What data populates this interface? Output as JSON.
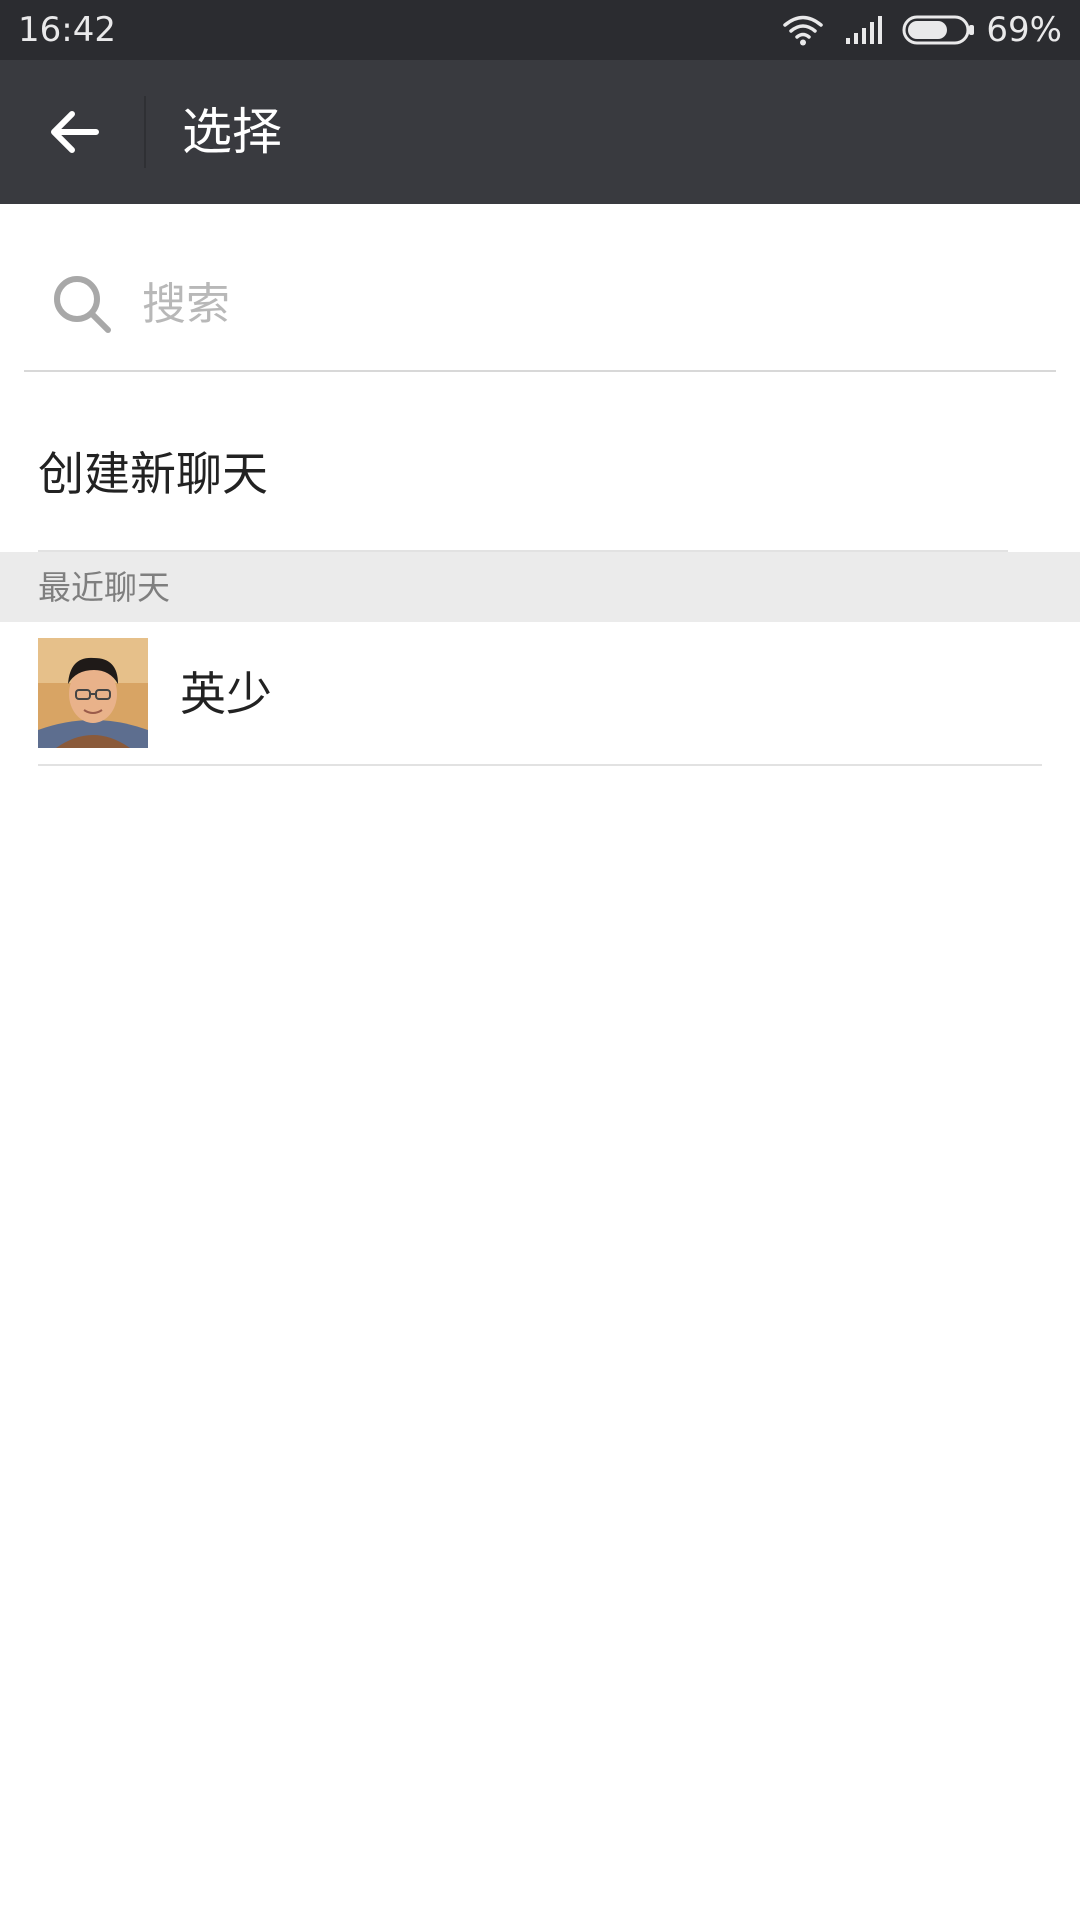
{
  "status_bar": {
    "time": "16:42",
    "battery_percent": "69%",
    "battery_level": 0.69,
    "icons": [
      "wifi-icon",
      "signal-icon",
      "battery-icon"
    ]
  },
  "app_bar": {
    "title": "选择",
    "back_icon": "arrow-left-icon",
    "colors": {
      "background": "#393a3f",
      "title": "#ffffff"
    }
  },
  "search": {
    "placeholder": "搜索",
    "value": "",
    "icon": "search-icon"
  },
  "new_chat": {
    "label": "创建新聊天"
  },
  "recent": {
    "header": "最近聊天",
    "items": [
      {
        "name": "英少",
        "avatar": "user-photo-avatar"
      }
    ]
  }
}
